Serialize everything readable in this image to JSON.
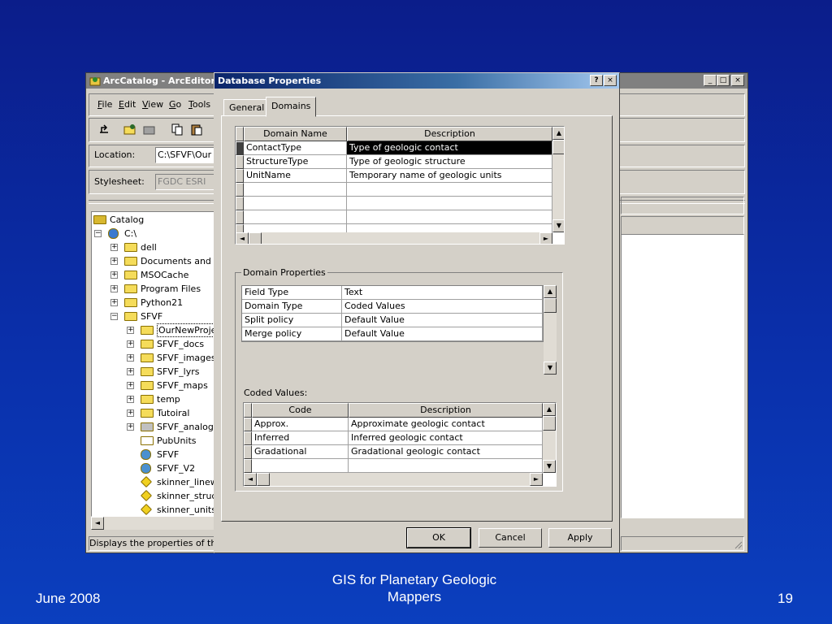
{
  "arccatalog": {
    "title": "ArcCatalog - ArcEditor",
    "menu": [
      "File",
      "Edit",
      "View",
      "Go",
      "Tools"
    ],
    "location_label": "Location:",
    "location_value": "C:\\SFVF\\Our",
    "stylesheet_label": "Stylesheet:",
    "stylesheet_value": "FGDC ESRI",
    "tree": [
      {
        "label": "Catalog",
        "icon": "catalog-icon"
      },
      {
        "label": "C:\\",
        "icon": "drive-icon"
      },
      {
        "label": "dell",
        "icon": "folder-icon"
      },
      {
        "label": "Documents and S",
        "icon": "folder-icon"
      },
      {
        "label": "MSOCache",
        "icon": "folder-icon"
      },
      {
        "label": "Program Files",
        "icon": "folder-icon"
      },
      {
        "label": "Python21",
        "icon": "folder-icon"
      },
      {
        "label": "SFVF",
        "icon": "folder-icon"
      },
      {
        "label": "OurNewProje",
        "icon": "folder-open-icon"
      },
      {
        "label": "SFVF_docs",
        "icon": "folder-icon"
      },
      {
        "label": "SFVF_images",
        "icon": "folder-icon"
      },
      {
        "label": "SFVF_lyrs",
        "icon": "folder-icon"
      },
      {
        "label": "SFVF_maps",
        "icon": "folder-icon"
      },
      {
        "label": "temp",
        "icon": "folder-icon"
      },
      {
        "label": "Tutoiral",
        "icon": "folder-icon"
      },
      {
        "label": "SFVF_analog",
        "icon": "database-icon"
      },
      {
        "label": "PubUnits",
        "icon": "table-icon"
      },
      {
        "label": "SFVF",
        "icon": "layer-file-icon"
      },
      {
        "label": "SFVF_V2",
        "icon": "layer-file-icon"
      },
      {
        "label": "skinner_linew",
        "icon": "shapefile-icon"
      },
      {
        "label": "skinner_struc",
        "icon": "shapefile-icon"
      },
      {
        "label": "skinner_units",
        "icon": "shapefile-icon"
      }
    ],
    "status": "Displays the properties of the"
  },
  "dialog": {
    "title": "Database Properties",
    "help_btn": "?",
    "close_btn": "×",
    "tabs": [
      "General",
      "Domains"
    ],
    "domains": {
      "headers": [
        "Domain Name",
        "Description"
      ],
      "rows": [
        [
          "ContactType",
          "Type of geologic contact"
        ],
        [
          "StructureType",
          "Type of geologic structure"
        ],
        [
          "UnitName",
          "Temporary name of geologic units"
        ]
      ]
    },
    "domain_properties": {
      "label": "Domain Properties",
      "rows": [
        [
          "Field Type",
          "Text"
        ],
        [
          "Domain Type",
          "Coded Values"
        ],
        [
          "Split policy",
          "Default Value"
        ],
        [
          "Merge policy",
          "Default Value"
        ]
      ]
    },
    "coded_values": {
      "label": "Coded Values:",
      "headers": [
        "Code",
        "Description"
      ],
      "rows": [
        [
          "Approx.",
          "Approximate geologic contact"
        ],
        [
          "Inferred",
          "Inferred geologic contact"
        ],
        [
          "Gradational",
          "Gradational geologic contact"
        ]
      ]
    },
    "buttons": {
      "ok": "OK",
      "cancel": "Cancel",
      "apply": "Apply"
    }
  },
  "footer": {
    "date": "June 2008",
    "title_line1": "GIS for Planetary Geologic",
    "title_line2": "Mappers",
    "page": "19"
  }
}
